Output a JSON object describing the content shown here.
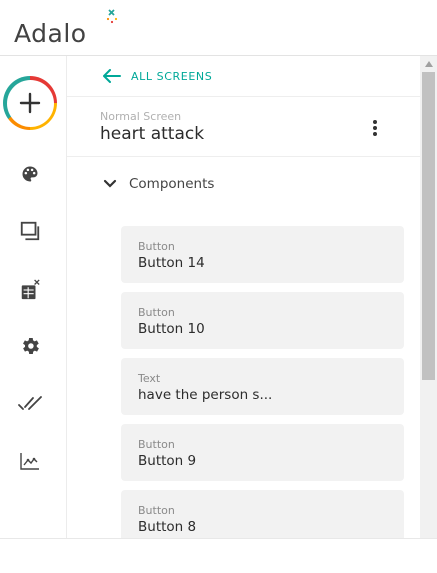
{
  "app": {
    "logo_text": "Adalo",
    "accent_color": "#00a898"
  },
  "left_rail": {
    "items": [
      {
        "name": "add",
        "icon": "plus-icon"
      },
      {
        "name": "branding",
        "icon": "palette-icon"
      },
      {
        "name": "screens",
        "icon": "screens-icon"
      },
      {
        "name": "database",
        "icon": "database-icon"
      },
      {
        "name": "settings",
        "icon": "gear-icon"
      },
      {
        "name": "publish",
        "icon": "double-check-icon"
      },
      {
        "name": "analytics",
        "icon": "analytics-icon"
      }
    ]
  },
  "panel": {
    "back_label": "ALL SCREENS",
    "screen_type": "Normal Screen",
    "screen_name": "heart attack",
    "section_label": "Components",
    "components": [
      {
        "type": "Button",
        "name": "Button 14"
      },
      {
        "type": "Button",
        "name": "Button 10"
      },
      {
        "type": "Text",
        "name": "have the person s..."
      },
      {
        "type": "Button",
        "name": "Button 9"
      },
      {
        "type": "Button",
        "name": "Button 8"
      }
    ]
  }
}
